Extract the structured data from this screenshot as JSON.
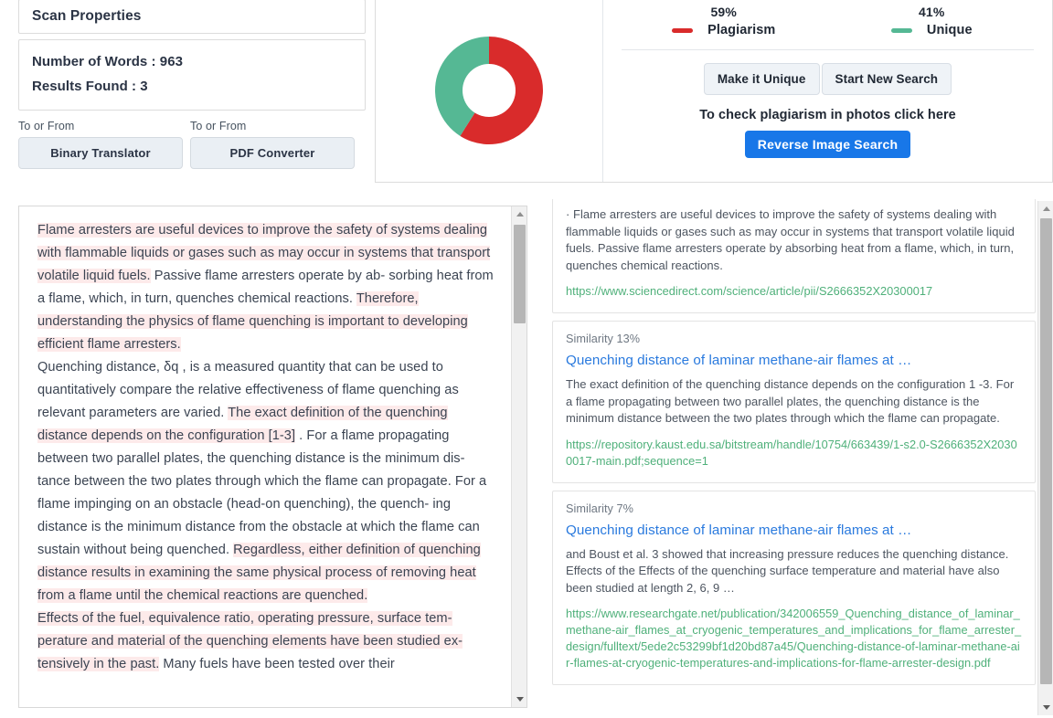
{
  "scan_properties": {
    "title": "Scan Properties",
    "words_label": "Number of Words : ",
    "words_value": "963",
    "results_label": "Results Found : ",
    "results_value": "3"
  },
  "tools": [
    {
      "label": "To or From",
      "button": "Binary Translator"
    },
    {
      "label": "To or From",
      "button": "PDF Converter"
    }
  ],
  "report": {
    "plagiarism_pct": "59%",
    "plagiarism_label": "Plagiarism",
    "unique_pct": "41%",
    "unique_label": "Unique",
    "make_unique_button": "Make it Unique",
    "start_new_search_button": "Start New Search",
    "photo_hint": "To check plagiarism in photos click here",
    "reverse_image_button": "Reverse Image Search",
    "plagiarism_color": "#d92b2b",
    "unique_color": "#55b894",
    "reverse_button_color": "#1877e8"
  },
  "chart_data": {
    "type": "pie",
    "title": "",
    "categories": [
      "Plagiarism",
      "Unique"
    ],
    "values": [
      59,
      41
    ],
    "colors": [
      "#d92b2b",
      "#55b894"
    ],
    "units": "percent",
    "donut": true,
    "inner_radius_ratio": 0.48,
    "start_angle_deg": 0,
    "direction": "clockwise",
    "legend_position": "right",
    "grid": false
  },
  "document": {
    "paragraphs": [
      {
        "runs": [
          {
            "text": "Flame arresters are useful devices to improve the safety of systems dealing with flammable liquids or gases such as may occur in systems that transport volatile liquid fuels.",
            "highlight": true
          },
          {
            "text": " Passive flame arresters operate by ab- sorbing heat from a flame, which, in turn, quenches chemical reactions. ",
            "highlight": false
          },
          {
            "text": "Therefore, understanding the physics of flame quenching is important to developing efficient flame arresters.",
            "highlight": true
          }
        ]
      },
      {
        "runs": [
          {
            "text": "Quenching distance, δq , is a measured quantity that can be used to quantitatively compare the relative effectiveness of flame quenching as relevant parameters are varied. ",
            "highlight": false
          },
          {
            "text": "The exact definition of the quenching distance depends on the configuration [1-3]",
            "highlight": true
          },
          {
            "text": " . For a flame propagating between two parallel plates, the quenching distance is the minimum dis- tance between the two plates through which the flame can propagate. For a flame impinging on an obstacle (head-on quenching), the quench- ing distance is the minimum distance from the obstacle at which the flame can sustain without being quenched. ",
            "highlight": false
          },
          {
            "text": "Regardless, either definition of quenching distance results in examining the same physical process of removing heat from a flame until the chemical reactions are quenched.",
            "highlight": true
          }
        ]
      },
      {
        "runs": [
          {
            "text": "Effects of the fuel, equivalence ratio, operating pressure, surface tem- perature and material of the quenching elements have been studied ex- tensively in the past.",
            "highlight": true
          },
          {
            "text": " Many fuels have been tested over their",
            "highlight": false
          }
        ]
      }
    ]
  },
  "results": [
    {
      "similarity": "",
      "title": "",
      "snippet": "· Flame arresters are useful devices to improve the safety of systems dealing with flammable liquids or gases such as may occur in systems that transport volatile liquid fuels. Passive flame arresters operate by absorbing heat from a flame, which, in turn, quenches chemical reactions.",
      "url": "https://www.sciencedirect.com/science/article/pii/S2666352X20300017",
      "clipped": true
    },
    {
      "similarity": "Similarity 13%",
      "title": "Quenching distance of laminar methane-air flames at …",
      "snippet": "The exact definition of the quenching distance depends on the configuration 1 -3. For a flame propagating between two parallel plates, the quenching distance is the minimum distance between the two plates through which the flame can propagate.",
      "url": "https://repository.kaust.edu.sa/bitstream/handle/10754/663439/1-s2.0-S2666352X20300017-main.pdf;sequence=1",
      "clipped": false
    },
    {
      "similarity": "Similarity 7%",
      "title": "Quenching distance of laminar methane-air flames at …",
      "snippet": "and Boust et al. 3 showed that increasing pressure reduces the quenching distance. Effects of the Effects of the quenching surface temperature and material have also been studied at length 2, 6, 9 …",
      "url": "https://www.researchgate.net/publication/342006559_Quenching_distance_of_laminar_methane-air_flames_at_cryogenic_temperatures_and_implications_for_flame_arrester_design/fulltext/5ede2c53299bf1d20bd87a45/Quenching-distance-of-laminar-methane-air-flames-at-cryogenic-temperatures-and-implications-for-flame-arrester-design.pdf",
      "clipped": false
    }
  ]
}
